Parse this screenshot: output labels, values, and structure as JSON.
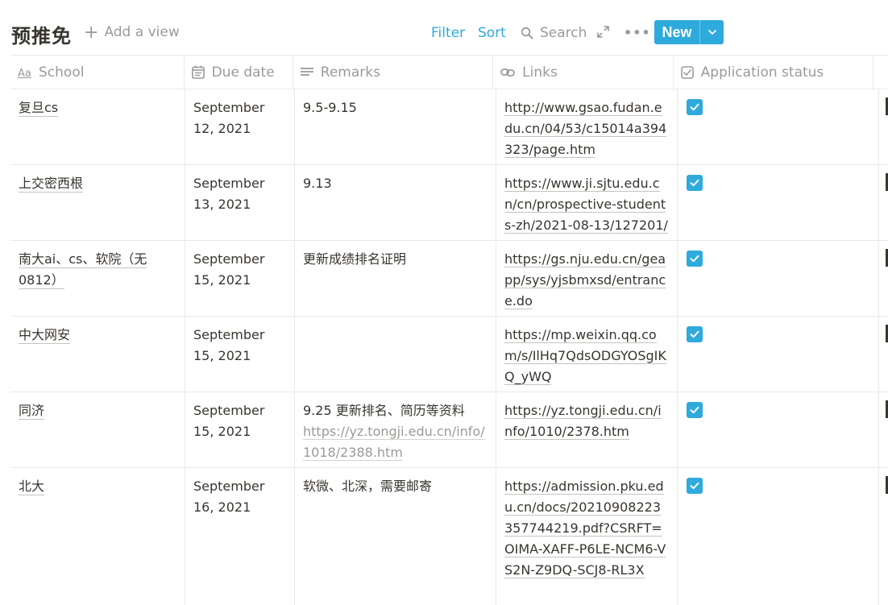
{
  "header": {
    "title": "预推免",
    "add_view": "Add a view",
    "filter": "Filter",
    "sort": "Sort",
    "search": "Search",
    "new": "New"
  },
  "columns": {
    "school": "School",
    "due_date": "Due date",
    "remarks": "Remarks",
    "links": "Links",
    "status": "Application status"
  },
  "rows": [
    {
      "school": "复旦cs",
      "due_date": "September 12, 2021",
      "remarks": "9.5-9.15",
      "remarks_link": "",
      "link": "http://www.gsao.fudan.edu.cn/04/53/c15014a394323/page.htm",
      "checked": true
    },
    {
      "school": "上交密西根",
      "due_date": "September 13, 2021",
      "remarks": "9.13",
      "remarks_link": "",
      "link": "https://www.ji.sjtu.edu.cn/cn/prospective-students-zh/2021-08-13/127201/",
      "checked": true
    },
    {
      "school": "南大ai、cs、软院（无0812）",
      "due_date": "September 15, 2021",
      "remarks": "更新成绩排名证明",
      "remarks_link": "",
      "link": "https://gs.nju.edu.cn/geapp/sys/yjsbmxsd/entrance.do",
      "checked": true
    },
    {
      "school": "中大网安",
      "due_date": "September 15, 2021",
      "remarks": "",
      "remarks_link": "",
      "link": "https://mp.weixin.qq.com/s/IlHq7QdsODGYOSgIKQ_yWQ",
      "checked": true
    },
    {
      "school": "同济",
      "due_date": "September 15, 2021",
      "remarks": "9.25 更新排名、简历等资料",
      "remarks_link": "https://yz.tongji.edu.cn/info/1018/2388.htm",
      "link": "https://yz.tongji.edu.cn/info/1010/2378.htm",
      "checked": true
    },
    {
      "school": "北大",
      "due_date": "September 16, 2021",
      "remarks": "软微、北深，需要邮寄",
      "remarks_link": "",
      "link": "https://admission.pku.edu.cn/docs/20210908223357744219.pdf?CSRFT=OIMA-XAFF-P6LE-NCM6-VS2N-Z9DQ-SCJ8-RL3X",
      "checked": true
    }
  ],
  "colors": {
    "accent": "#2eaadc",
    "text": "#37352f",
    "muted": "#9b9a97",
    "border": "#e9e9e7"
  },
  "icons": {
    "add_view": "plus-icon",
    "search": "search-icon",
    "expand": "expand-icon",
    "more": "more-icon",
    "new_dropdown": "chevron-down-icon",
    "school": "text-type-icon",
    "due_date": "calendar-icon",
    "remarks": "text-lines-icon",
    "links": "link-icon",
    "status": "checkbox-icon",
    "checked": "checkmark-icon"
  }
}
